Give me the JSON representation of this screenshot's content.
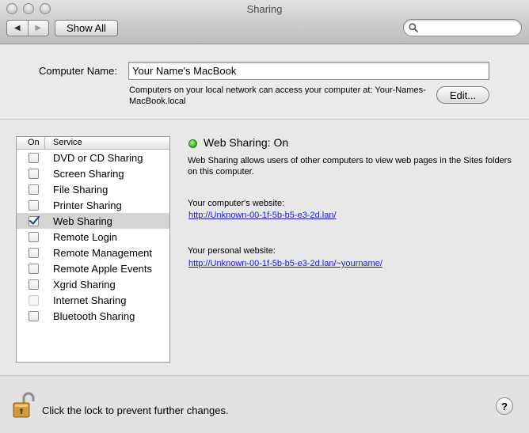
{
  "window": {
    "title": "Sharing"
  },
  "toolbar": {
    "back_glyph": "◀",
    "forward_glyph": "▶",
    "show_all_label": "Show All",
    "search_value": "",
    "search_placeholder": ""
  },
  "computer_name": {
    "label": "Computer Name:",
    "value": "Your Name's MacBook",
    "description": "Computers on your local network can access your computer at: Your-Names-MacBook.local",
    "edit_label": "Edit..."
  },
  "services": {
    "header_on": "On",
    "header_service": "Service",
    "items": [
      {
        "label": "DVD or CD Sharing",
        "checked": false,
        "enabled": true,
        "selected": false
      },
      {
        "label": "Screen Sharing",
        "checked": false,
        "enabled": true,
        "selected": false
      },
      {
        "label": "File Sharing",
        "checked": false,
        "enabled": true,
        "selected": false
      },
      {
        "label": "Printer Sharing",
        "checked": false,
        "enabled": true,
        "selected": false
      },
      {
        "label": "Web Sharing",
        "checked": true,
        "enabled": true,
        "selected": true
      },
      {
        "label": "Remote Login",
        "checked": false,
        "enabled": true,
        "selected": false
      },
      {
        "label": "Remote Management",
        "checked": false,
        "enabled": true,
        "selected": false
      },
      {
        "label": "Remote Apple Events",
        "checked": false,
        "enabled": true,
        "selected": false
      },
      {
        "label": "Xgrid Sharing",
        "checked": false,
        "enabled": true,
        "selected": false
      },
      {
        "label": "Internet Sharing",
        "checked": false,
        "enabled": false,
        "selected": false
      },
      {
        "label": "Bluetooth Sharing",
        "checked": false,
        "enabled": true,
        "selected": false
      }
    ]
  },
  "detail": {
    "status_title": "Web Sharing: On",
    "status_color": "#38b51c",
    "description": "Web Sharing allows users of other computers to view web pages in the Sites folders on this computer.",
    "computer_site_label": "Your computer's website:",
    "computer_site_url": "http://Unknown-00-1f-5b-b5-e3-2d.lan/",
    "personal_site_label": "Your personal website:",
    "personal_site_url": "http://Unknown-00-1f-5b-b5-e3-2d.lan/~yourname/"
  },
  "footer": {
    "lock_text": "Click the lock to prevent further changes.",
    "help_label": "?"
  }
}
